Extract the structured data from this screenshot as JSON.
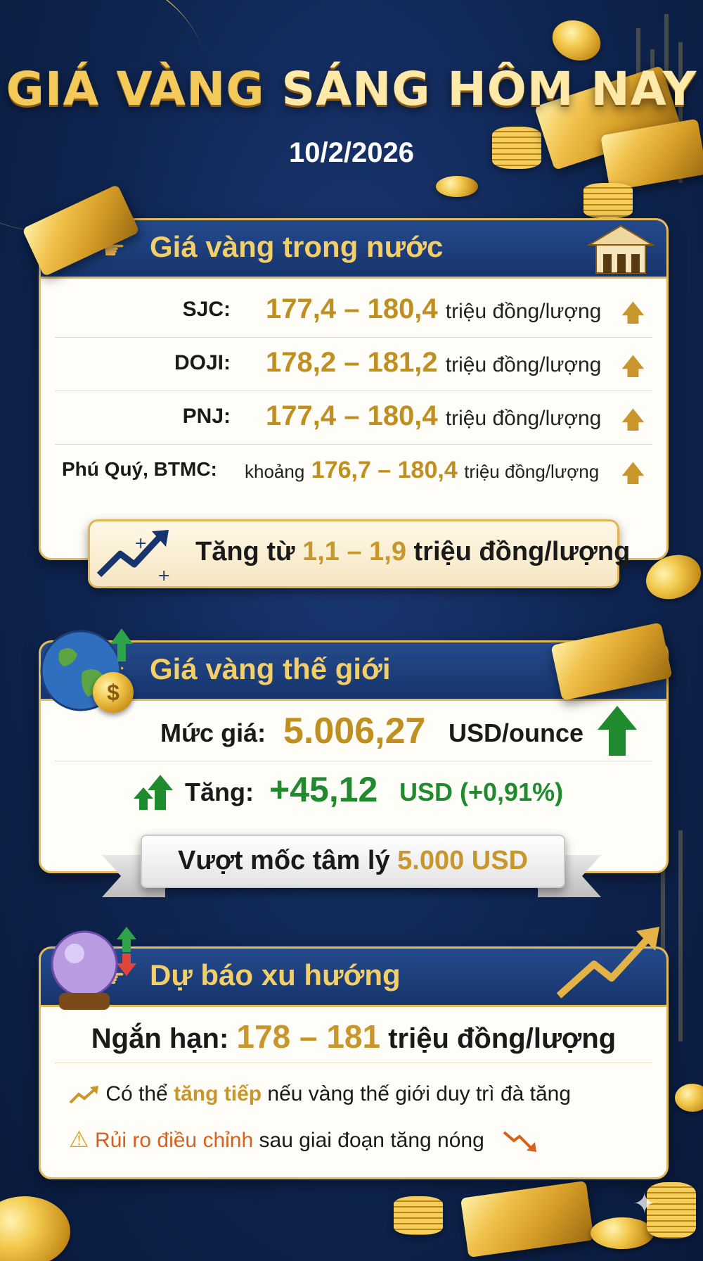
{
  "header": {
    "title_part1": "GIÁ VÀNG",
    "title_part2": "SÁNG HÔM NAY",
    "date": "10/2/2026"
  },
  "domestic": {
    "heading": "Giá vàng trong nước",
    "rows": [
      {
        "label": "SJC:",
        "prefix": "",
        "value": "177,4 – 180,4",
        "unit": "triệu đồng/lượng",
        "trend": "up"
      },
      {
        "label": "DOJI:",
        "prefix": "",
        "value": "178,2 – 181,2",
        "unit": "triệu đồng/lượng",
        "trend": "up"
      },
      {
        "label": "PNJ:",
        "prefix": "",
        "value": "177,4 – 180,4",
        "unit": "triệu đồng/lượng",
        "trend": "up"
      },
      {
        "label": "Phú Quý, BTMC:",
        "prefix": "khoảng",
        "value": "176,7 – 180,4",
        "unit": "triệu đồng/lượng",
        "trend": "up"
      }
    ],
    "increase_prefix": "Tăng từ",
    "increase_value": "1,1 – 1,9",
    "increase_unit": "triệu đồng/lượng"
  },
  "world": {
    "heading": "Giá vàng thế giới",
    "price_label": "Mức giá:",
    "price_value": "5.006,27",
    "price_unit": "USD/ounce",
    "change_label": "Tăng:",
    "change_value": "+45,12",
    "change_unit": "USD (+0,91%)",
    "ribbon_prefix": "Vượt mốc tâm lý",
    "ribbon_value": "5.000 USD"
  },
  "forecast": {
    "heading": "Dự báo xu hướng",
    "short_label": "Ngắn hạn:",
    "short_value": "178 – 181",
    "short_unit": "triệu đồng/lượng",
    "line1_pre": "Có thể",
    "line1_hl": "tăng tiếp",
    "line1_post": "nếu vàng thế giới duy trì đà tăng",
    "line2_hl": "Rủi ro điều chỉnh",
    "line2_post": "sau giai đoạn tăng nóng"
  },
  "colors": {
    "gold": "#c8962a",
    "green": "#1f8a2e",
    "orange": "#d9601a",
    "navy": "#17346c"
  },
  "icons": [
    "pointing-hand-icon",
    "pagoda-icon",
    "up-arrow-icon",
    "trend-chart-icon",
    "globe-icon",
    "dollar-coin-icon",
    "crystal-ball-icon",
    "warning-icon",
    "down-trend-icon"
  ]
}
